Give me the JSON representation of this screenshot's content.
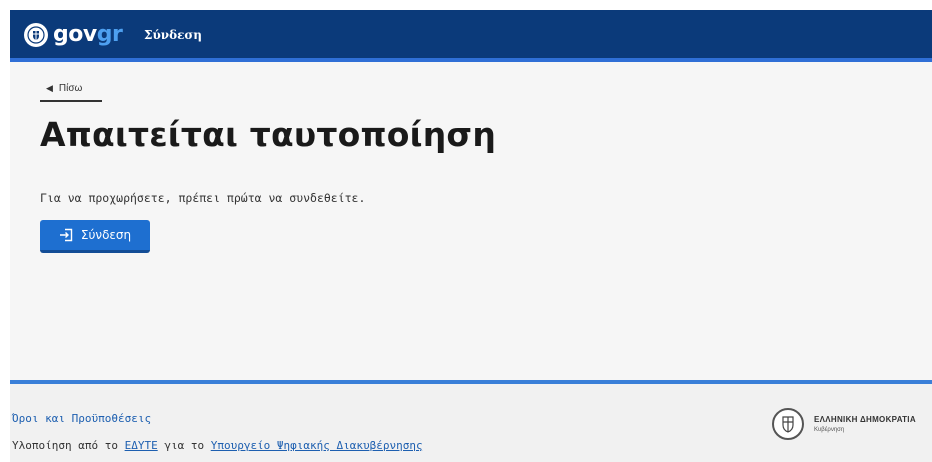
{
  "header": {
    "logo_gov": "gov",
    "logo_gr": "gr",
    "signin_link": "Σύνδεση",
    "colors": {
      "bar": "#0b3a7a",
      "accent": "#2f6fd6",
      "logo_gr": "#4ea0f0"
    }
  },
  "main": {
    "back_label": "Πίσω",
    "title": "Απαιτείται ταυτοποίηση",
    "description": "Για να προχωρήσετε, πρέπει πρώτα να συνδεθείτε.",
    "signin_button": {
      "label": "Σύνδεση",
      "icon": "login-icon",
      "color": "#1e6fd0"
    }
  },
  "footer": {
    "terms_link": "Όροι και Προϋποθέσεις",
    "implementation_prefix": "Υλοποίηση από το ",
    "implementation_org": "ΕΔΥΤΕ",
    "implementation_mid": " για το ",
    "implementation_ministry": "Υπουργείο Ψηφιακής Διακυβέρνησης",
    "gov_logo_name": "ΕΛΛΗΝΙΚΗ ΔΗΜΟΚΡΑΤΙΑ",
    "gov_logo_sub": "Κυβέρνηση"
  }
}
